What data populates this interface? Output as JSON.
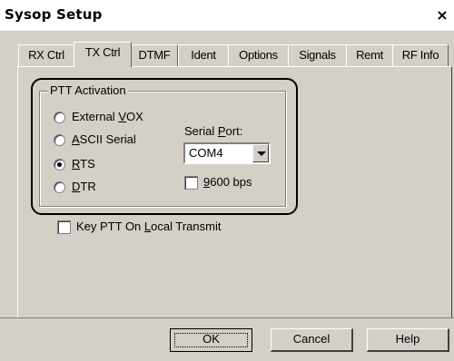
{
  "window": {
    "title": "Sysop Setup",
    "close_glyph": "×"
  },
  "tabs": [
    {
      "label": "RX Ctrl",
      "active": false
    },
    {
      "label": "TX Ctrl",
      "active": true
    },
    {
      "label": "DTMF",
      "active": false
    },
    {
      "label": "Ident",
      "active": false
    },
    {
      "label": "Options",
      "active": false
    },
    {
      "label": "Signals",
      "active": false
    },
    {
      "label": "Remt",
      "active": false
    },
    {
      "label": "RF Info",
      "active": false
    }
  ],
  "ptt_group": {
    "label": "PTT Activation",
    "options": [
      {
        "pre": "External ",
        "acc": "V",
        "post": "OX",
        "selected": false
      },
      {
        "pre": "",
        "acc": "A",
        "post": "SCII Serial",
        "selected": false
      },
      {
        "pre": "",
        "acc": "R",
        "post": "TS",
        "selected": true
      },
      {
        "pre": "",
        "acc": "D",
        "post": "TR",
        "selected": false
      }
    ],
    "serial_port": {
      "pre": "Serial ",
      "acc": "P",
      "post": "ort:",
      "value": "COM4"
    },
    "baud_checkbox": {
      "pre": "",
      "acc": "9",
      "post": "600 bps",
      "checked": false
    }
  },
  "key_ptt_checkbox": {
    "pre": "Key PTT On ",
    "acc": "L",
    "post": "ocal Transmit",
    "checked": false
  },
  "buttons": {
    "ok": "OK",
    "cancel": "Cancel",
    "help": "Help"
  }
}
